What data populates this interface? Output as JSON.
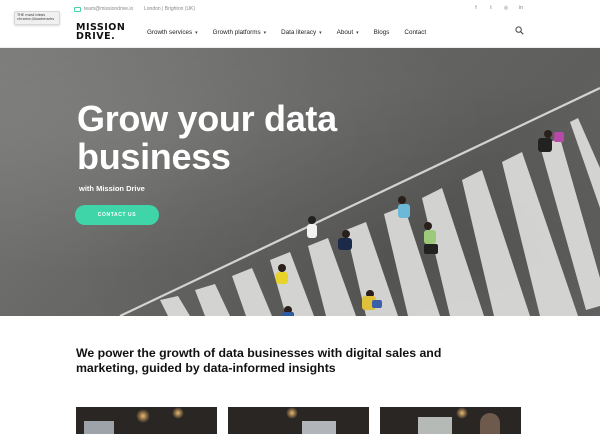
{
  "badge": {
    "text": "THE most ideas chrome://bookmarks"
  },
  "topbar": {
    "email": "team@missiondrive.io",
    "location": "London | Brighton (UK)",
    "social": [
      "facebook-icon",
      "twitter-icon",
      "instagram-icon",
      "linkedin-icon"
    ],
    "social_glyphs": [
      "f",
      "t",
      "◎",
      "in"
    ]
  },
  "header": {
    "logo_line1": "MISSION",
    "logo_line2": "DRIVE.",
    "nav": [
      {
        "label": "Growth services",
        "dropdown": true
      },
      {
        "label": "Growth platforms",
        "dropdown": true
      },
      {
        "label": "Data literacy",
        "dropdown": true
      },
      {
        "label": "About",
        "dropdown": true
      },
      {
        "label": "Blogs",
        "dropdown": false
      },
      {
        "label": "Contact",
        "dropdown": false
      }
    ],
    "chevron": "▾"
  },
  "hero": {
    "title_line1": "Grow your data",
    "title_line2": "business",
    "subtitle": "with Mission Drive",
    "cta": "CONTACT US"
  },
  "section": {
    "tagline": "We power the growth of data businesses with digital sales and marketing, guided by data-informed insights"
  },
  "colors": {
    "accent": "#3fd5a8",
    "text": "#111111",
    "road": "#6c6c6a"
  }
}
